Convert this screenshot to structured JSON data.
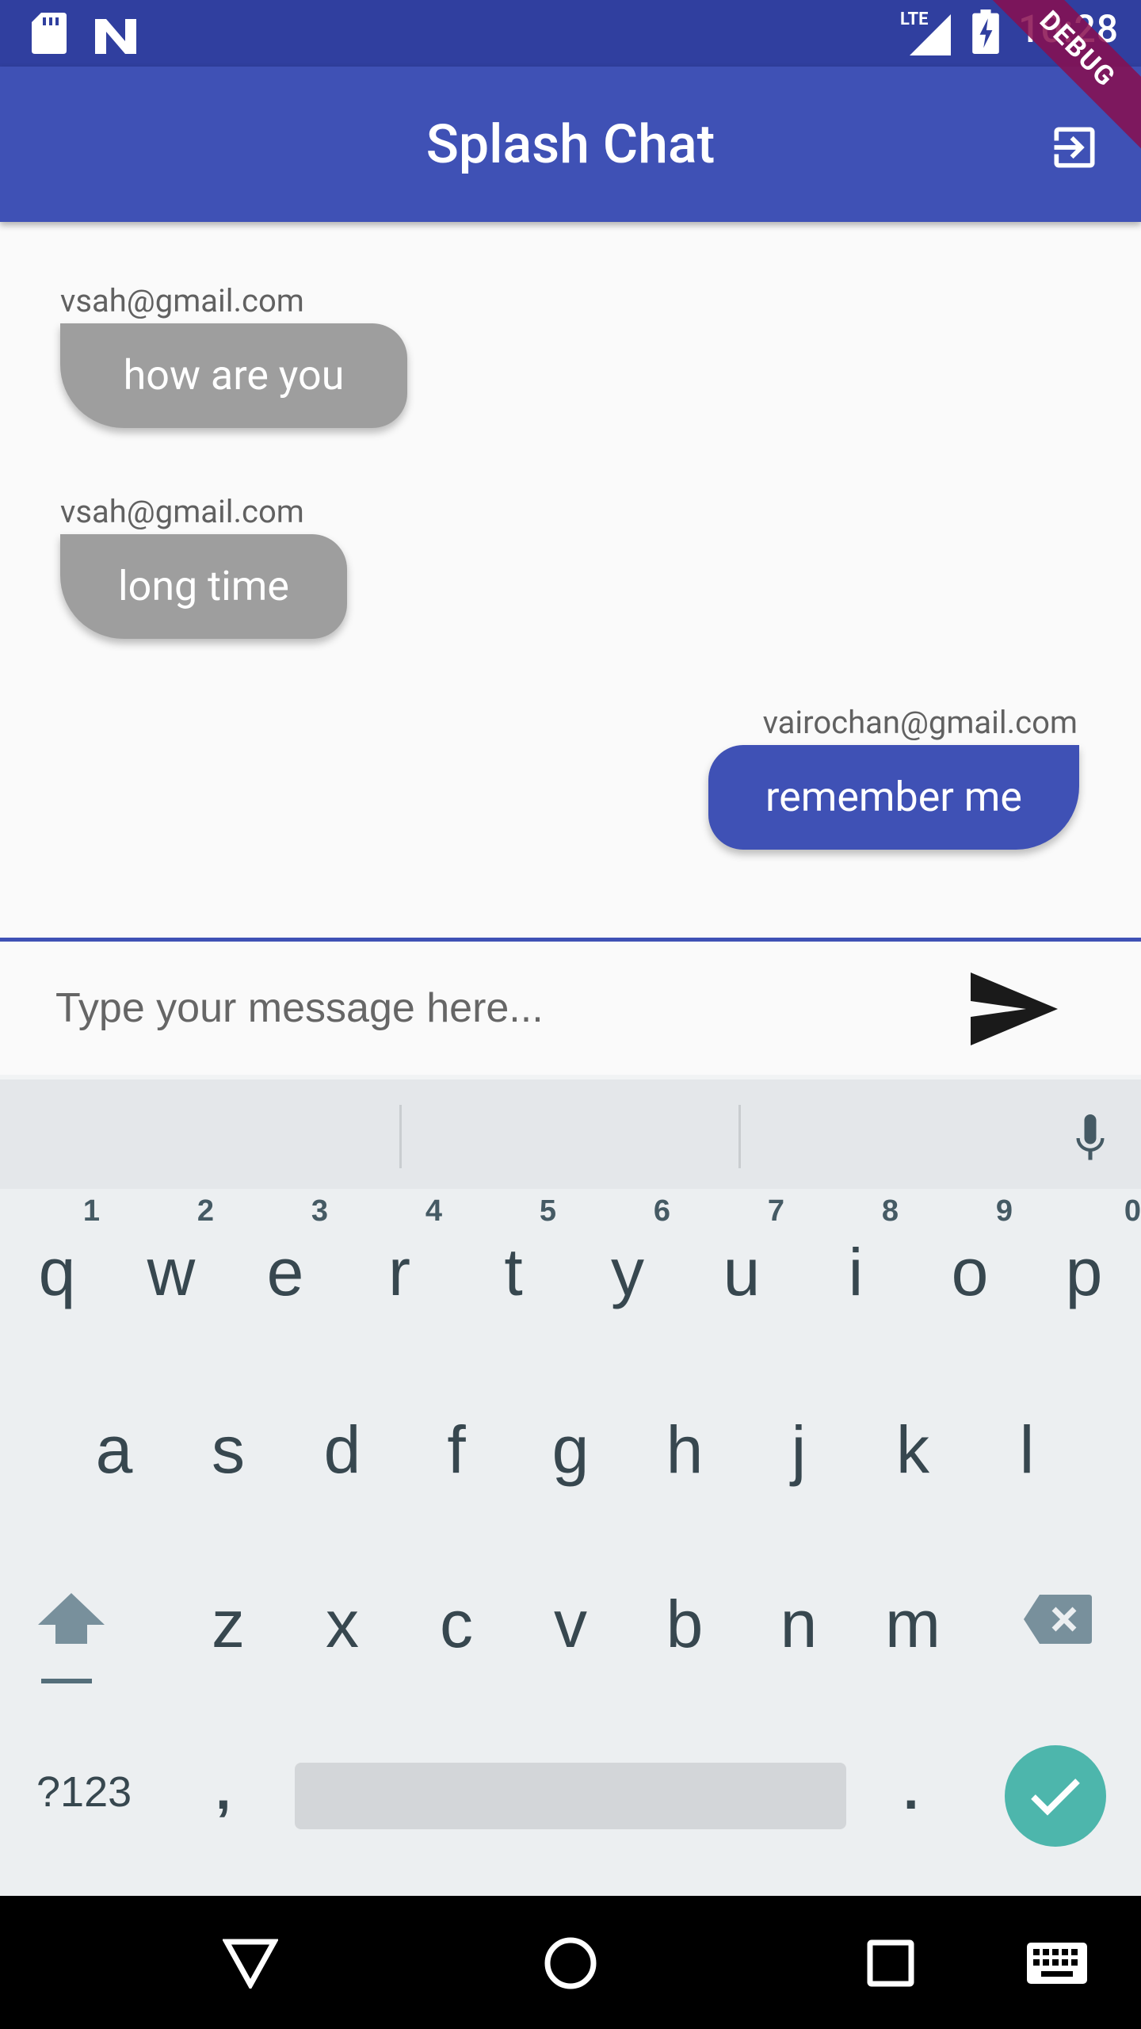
{
  "status_bar": {
    "time": "10:28",
    "network": "LTE",
    "colors": {
      "background": "#303f9f"
    }
  },
  "app_bar": {
    "title": "Splash Chat",
    "debug_label": "DEBUG",
    "exit_icon": "exit-to-app-icon",
    "colors": {
      "background": "#3f51b5"
    }
  },
  "messages": [
    {
      "sender": "vsah@gmail.com",
      "text": "how are you",
      "is_me": false
    },
    {
      "sender": "vsah@gmail.com",
      "text": "long time",
      "is_me": false
    },
    {
      "sender": "vairochan@gmail.com",
      "text": "remember me",
      "is_me": true
    }
  ],
  "compose": {
    "placeholder": "Type your message here...",
    "value": "",
    "send_icon": "send-icon"
  },
  "keyboard": {
    "row1": [
      {
        "ch": "q",
        "hint": "1"
      },
      {
        "ch": "w",
        "hint": "2"
      },
      {
        "ch": "e",
        "hint": "3"
      },
      {
        "ch": "r",
        "hint": "4"
      },
      {
        "ch": "t",
        "hint": "5"
      },
      {
        "ch": "y",
        "hint": "6"
      },
      {
        "ch": "u",
        "hint": "7"
      },
      {
        "ch": "i",
        "hint": "8"
      },
      {
        "ch": "o",
        "hint": "9"
      },
      {
        "ch": "p",
        "hint": "0"
      }
    ],
    "row2": [
      "a",
      "s",
      "d",
      "f",
      "g",
      "h",
      "j",
      "k",
      "l"
    ],
    "row3": [
      "z",
      "x",
      "c",
      "v",
      "b",
      "n",
      "m"
    ],
    "symbols_label": "?123",
    "comma_label": ",",
    "period_label": ".",
    "colors": {
      "done": "#4db6ac",
      "background": "#eceff1"
    }
  },
  "nav": {
    "back_icon": "back-triangle-icon",
    "home_icon": "home-circle-icon",
    "recents_icon": "recents-square-icon",
    "keyboard_icon": "keyboard-icon"
  }
}
